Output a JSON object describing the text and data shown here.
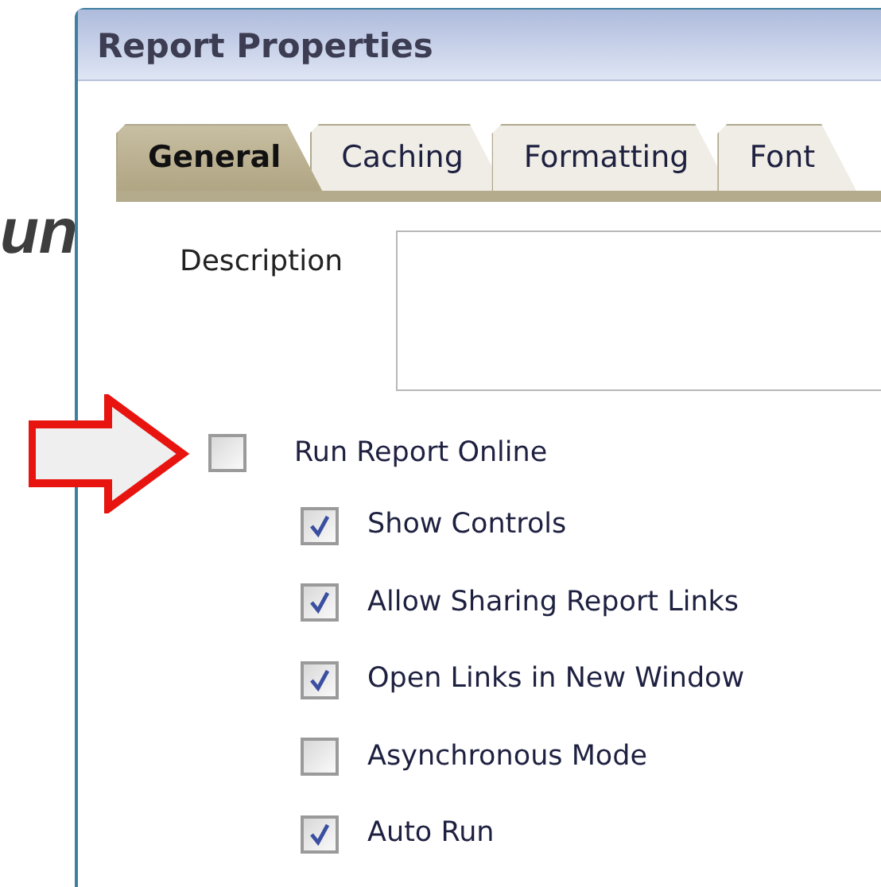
{
  "background_text": "un",
  "window": {
    "title": "Report Properties"
  },
  "tabs": [
    {
      "label": "General",
      "selected": true
    },
    {
      "label": "Caching",
      "selected": false
    },
    {
      "label": "Formatting",
      "selected": false
    },
    {
      "label": "Font",
      "selected": false
    }
  ],
  "description": {
    "label": "Description"
  },
  "run_report_online": {
    "label": "Run Report Online",
    "checked": false
  },
  "options": [
    {
      "label": "Show Controls",
      "checked": true
    },
    {
      "label": "Allow Sharing Report Links",
      "checked": true
    },
    {
      "label": "Open Links in New Window",
      "checked": true
    },
    {
      "label": "Asynchronous Mode",
      "checked": false
    },
    {
      "label": "Auto Run",
      "checked": true
    }
  ]
}
